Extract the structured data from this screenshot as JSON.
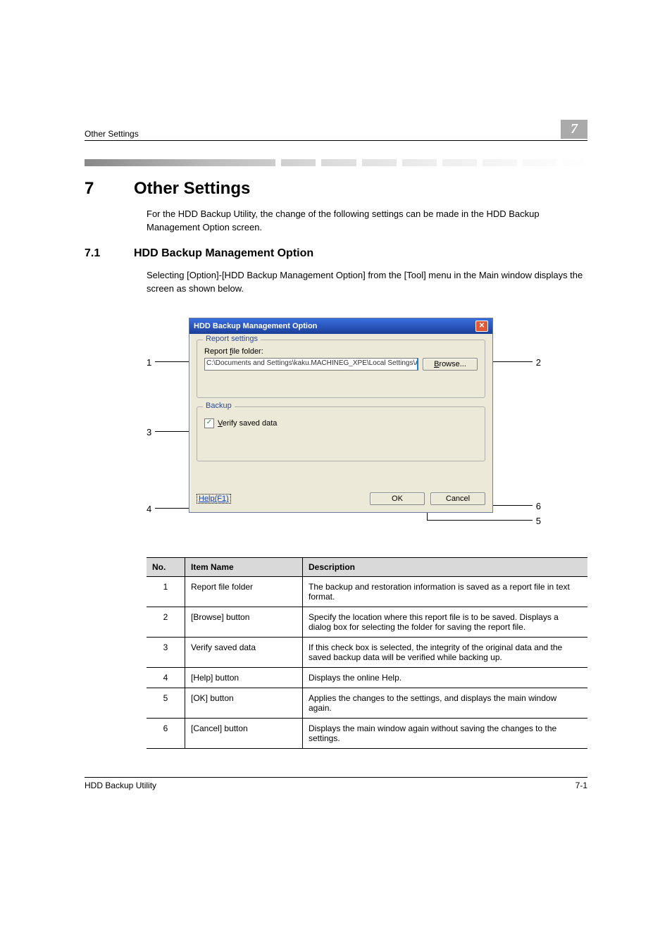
{
  "header": {
    "crumb": "Other Settings",
    "chapter_badge": "7"
  },
  "chapter": {
    "number": "7",
    "title": "Other Settings",
    "intro": "For the HDD Backup Utility, the change of the following settings can be made in the HDD Backup Management Option screen."
  },
  "section": {
    "number": "7.1",
    "title": "HDD Backup Management Option",
    "lead": "Selecting [Option]-[HDD Backup Management Option] from the [Tool] menu in the Main window displays the screen as shown below."
  },
  "dialog": {
    "title": "HDD Backup Management Option",
    "group_report": "Report settings",
    "report_label": "Report file folder:",
    "report_label_ul": "f",
    "report_path": "C:\\Documents and Settings\\kaku.MACHINEG_XPE\\Local Settings\\Application",
    "browse": "Browse...",
    "browse_ul": "B",
    "group_backup": "Backup",
    "verify": "Verify saved data",
    "verify_ul": "V",
    "verify_checked": true,
    "help": "Help(F1)",
    "ok": "OK",
    "cancel": "Cancel"
  },
  "callouts": [
    "1",
    "2",
    "3",
    "4",
    "5",
    "6"
  ],
  "table": {
    "headers": {
      "no": "No.",
      "item": "Item Name",
      "desc": "Description"
    },
    "rows": [
      {
        "no": "1",
        "item": "Report file folder",
        "desc": "The backup and restoration information is saved as a report file in text format."
      },
      {
        "no": "2",
        "item": "[Browse] button",
        "desc": "Specify the location where this report file is to be saved. Displays a dialog box for selecting the folder for saving the report file."
      },
      {
        "no": "3",
        "item": "Verify saved data",
        "desc": "If this check box is selected, the integrity of the original data and the saved backup data will be verified while backing up."
      },
      {
        "no": "4",
        "item": "[Help] button",
        "desc": "Displays the online Help."
      },
      {
        "no": "5",
        "item": "[OK] button",
        "desc": "Applies the changes to the settings, and displays the main window again."
      },
      {
        "no": "6",
        "item": "[Cancel] button",
        "desc": "Displays the main window again without saving the changes to the settings."
      }
    ]
  },
  "footer": {
    "product": "HDD Backup Utility",
    "page": "7-1"
  }
}
